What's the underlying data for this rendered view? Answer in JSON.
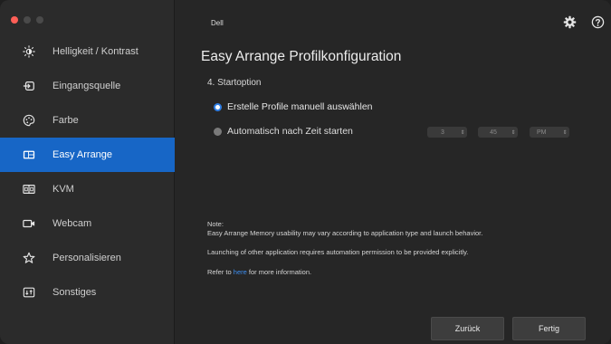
{
  "window": {
    "controls": [
      "close",
      "minimize",
      "zoom"
    ]
  },
  "sidebar": {
    "items": [
      {
        "label": "Helligkeit / Kontrast",
        "icon": "brightness-icon",
        "active": false
      },
      {
        "label": "Eingangsquelle",
        "icon": "input-source-icon",
        "active": false
      },
      {
        "label": "Farbe",
        "icon": "color-palette-icon",
        "active": false
      },
      {
        "label": "Easy Arrange",
        "icon": "easy-arrange-icon",
        "active": true
      },
      {
        "label": "KVM",
        "icon": "kvm-icon",
        "active": false
      },
      {
        "label": "Webcam",
        "icon": "webcam-icon",
        "active": false
      },
      {
        "label": "Personalisieren",
        "icon": "star-icon",
        "active": false
      },
      {
        "label": "Sonstiges",
        "icon": "misc-icon",
        "active": false
      }
    ]
  },
  "header": {
    "brand": "Dell",
    "icons": [
      "settings-gear-icon",
      "help-icon"
    ]
  },
  "main": {
    "title": "Easy Arrange Profilkonfiguration",
    "section": "4. Startoption",
    "options": [
      {
        "label": "Erstelle Profile manuell auswählen",
        "selected": true
      },
      {
        "label": "Automatisch nach Zeit starten",
        "selected": false
      }
    ],
    "time": {
      "hour": "3",
      "minute": "45",
      "period": "PM"
    },
    "note": {
      "line1": "Note:",
      "line2": "Easy Arrange Memory usability may vary according to application type and launch behavior.",
      "line3": "Launching of other application requires automation permission to be provided explicitly.",
      "refer_prefix": "Refer to",
      "refer_link": "here",
      "refer_suffix": "for more information."
    }
  },
  "footer": {
    "back_label": "Zurück",
    "done_label": "Fertig"
  },
  "colors": {
    "accent": "#1766c6",
    "link": "#3d8ef0",
    "background": "#262626",
    "sidebar": "#2b2b2b"
  }
}
